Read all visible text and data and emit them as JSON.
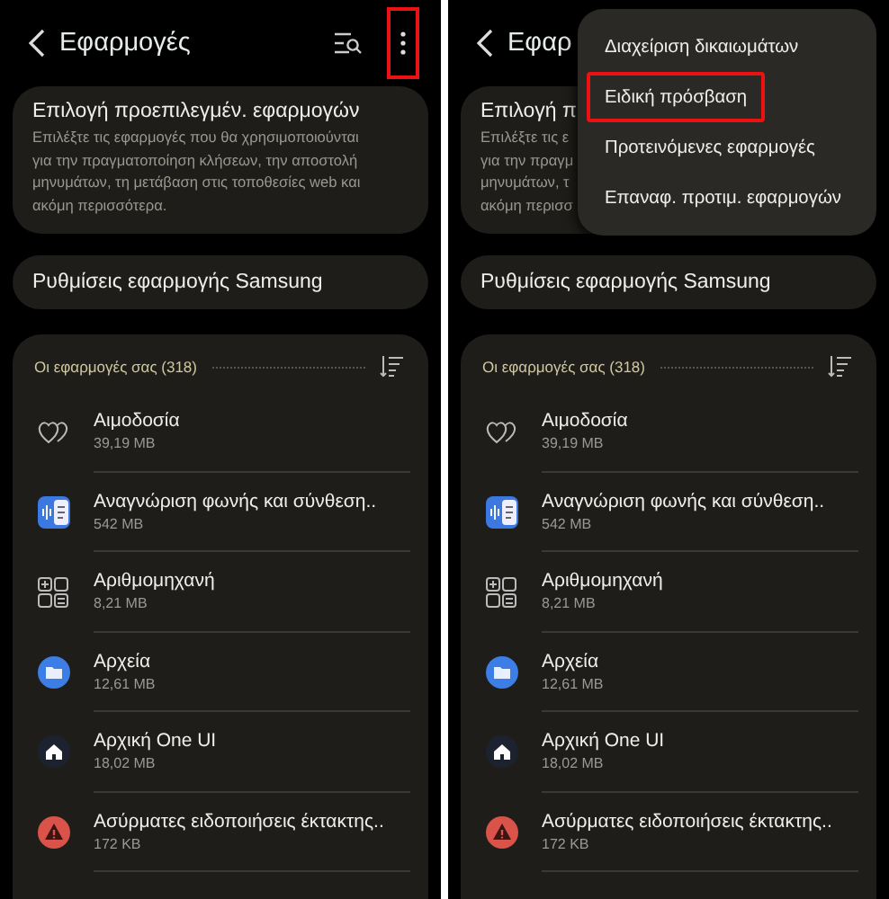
{
  "screens": [
    {
      "header": {
        "title": "Εφαρμογές",
        "show_actions": true,
        "more_highlighted": true
      },
      "default_apps": {
        "title": "Επιλογή προεπιλεγμέν. εφαρμογών",
        "description_lines": [
          "Επιλέξτε τις εφαρμογές που θα χρησιμοποιούνται",
          "για την πραγματοποίηση κλήσεων, την αποστολή",
          "μηνυμάτων, τη μετάβαση στις τοποθεσίες web και",
          "ακόμη περισσότερα."
        ]
      },
      "samsung_settings": "Ρυθμίσεις εφαρμογής Samsung",
      "apps": {
        "heading": "Οι εφαρμογές σας (318)",
        "items": [
          {
            "name": "Αιμοδοσία",
            "size": "39,19 MB",
            "kind": "hearts"
          },
          {
            "name": "Αναγνώριση φωνής και σύνθεση..",
            "size": "542 MB",
            "kind": "voice"
          },
          {
            "name": "Αριθμομηχανή",
            "size": "8,21 MB",
            "kind": "calculator"
          },
          {
            "name": "Αρχεία",
            "size": "12,61 MB",
            "kind": "folder"
          },
          {
            "name": "Αρχική One UI",
            "size": "18,02 MB",
            "kind": "home"
          },
          {
            "name": "Ασύρματες ειδοποιήσεις έκτακτης..",
            "size": "172 KB",
            "kind": "alert"
          }
        ]
      }
    },
    {
      "header": {
        "title": "Εφαρ"
      },
      "default_apps": {
        "title": "Επιλογή π",
        "description_lines": [
          "Επιλέξτε τις ε",
          "για την πραγμ",
          "μηνυμάτων, τ",
          "ακόμη περισσ"
        ]
      },
      "samsung_settings": "Ρυθμίσεις εφαρμογής Samsung",
      "apps": {
        "heading": "Οι εφαρμογές σας (318)",
        "items": [
          {
            "name": "Αιμοδοσία",
            "size": "39,19 MB",
            "kind": "hearts"
          },
          {
            "name": "Αναγνώριση φωνής και σύνθεση..",
            "size": "542 MB",
            "kind": "voice"
          },
          {
            "name": "Αριθμομηχανή",
            "size": "8,21 MB",
            "kind": "calculator"
          },
          {
            "name": "Αρχεία",
            "size": "12,61 MB",
            "kind": "folder"
          },
          {
            "name": "Αρχική One UI",
            "size": "18,02 MB",
            "kind": "home"
          },
          {
            "name": "Ασύρματες ειδοποιήσεις έκτακτης..",
            "size": "172 KB",
            "kind": "alert"
          }
        ]
      },
      "menu": [
        {
          "label": "Διαχείριση δικαιωμάτων",
          "highlighted": false
        },
        {
          "label": "Ειδική πρόσβαση",
          "highlighted": true
        },
        {
          "label": "Προτεινόμενες εφαρμογές",
          "highlighted": false
        },
        {
          "label": "Επαναφ. προτιμ. εφαρμογών",
          "highlighted": false
        }
      ]
    }
  ]
}
